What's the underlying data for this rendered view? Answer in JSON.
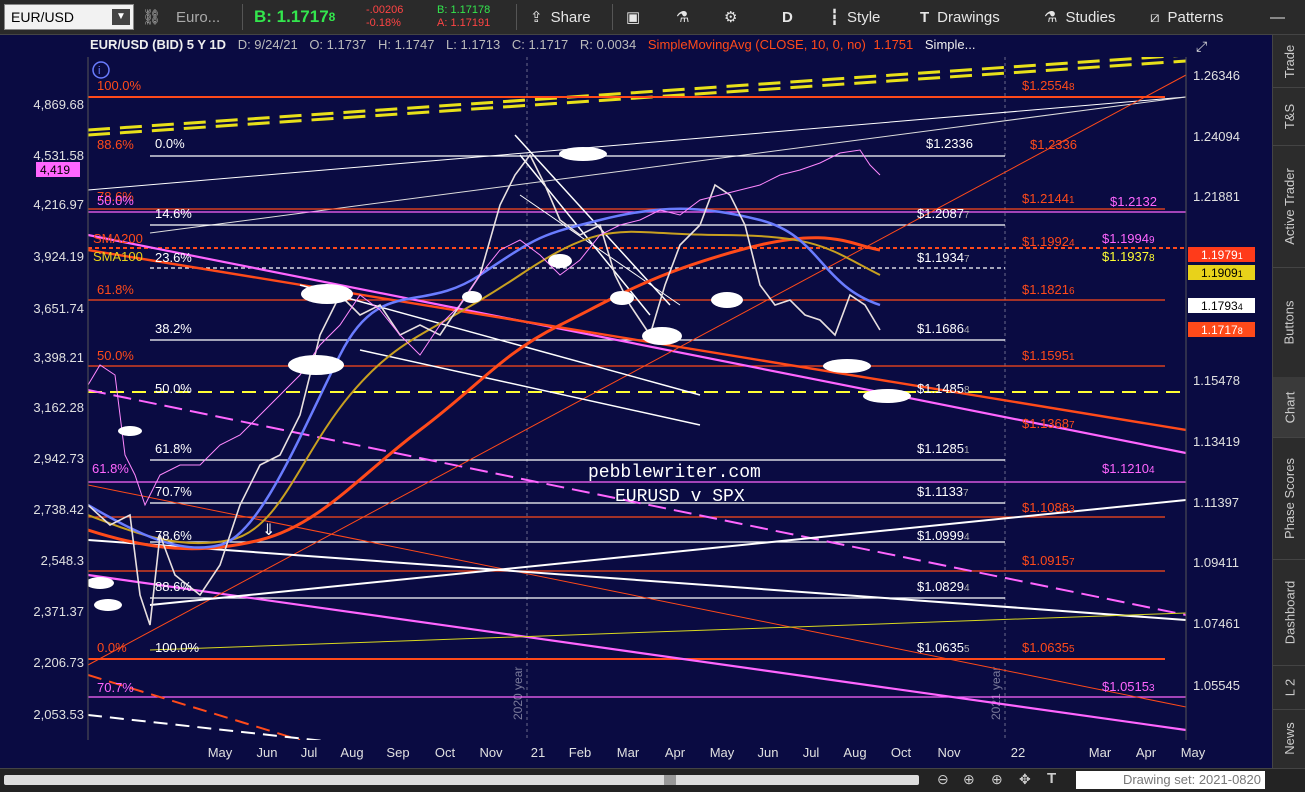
{
  "toolbar": {
    "symbol": "EUR/USD",
    "symbol_desc": "Euro...",
    "bid_label": "B: 1.1717",
    "bid_frac": "8",
    "change": "-.00206",
    "change_pct": "-0.18%",
    "bid_small": "B: 1.17178",
    "ask_small": "A: 1.17191",
    "share": "Share",
    "period": "D",
    "style": "Style",
    "drawings": "Drawings",
    "studies": "Studies",
    "patterns": "Patterns"
  },
  "header": {
    "title": "EUR/USD (BID) 5 Y 1D",
    "date": "D: 9/24/21",
    "open": "O: 1.1737",
    "high": "H: 1.1747",
    "low": "L: 1.1713",
    "close": "C: 1.1717",
    "range": "R: 0.0034",
    "study": "SimpleMovingAvg (CLOSE, 10, 0, no)",
    "study_value": "1.1751",
    "study2": "Simple..."
  },
  "colors": {
    "bg": "#0a0b42",
    "white": "#ffffff",
    "orange": "#ff4a1a",
    "magenta": "#ff66ff",
    "yellow": "#ffff33",
    "blue": "#6a7cff"
  },
  "right_axis": [
    "1.26346",
    "1.24094",
    "1.21881",
    "1.19",
    "1.17",
    "1.15478",
    "1.13419",
    "1.11397",
    "1.09411",
    "1.07461",
    "1.05545"
  ],
  "left_axis": [
    "4,869.68",
    "4,531.58",
    "4,216.97",
    "3,924.19",
    "3,651.74",
    "3,398.21",
    "3,162.28",
    "2,942.73",
    "2,738.42",
    "2,548.3",
    "2,371.37",
    "2,206.73",
    "2,053.53"
  ],
  "x_axis": [
    "May",
    "Jun",
    "Jul",
    "Aug",
    "Sep",
    "Oct",
    "Nov",
    "21",
    "Feb",
    "Mar",
    "Apr",
    "May",
    "Jun",
    "Jul",
    "Aug",
    "Oct",
    "Nov",
    "22",
    "Mar",
    "Apr",
    "May"
  ],
  "year_labels": [
    "2020 year",
    "2021 year"
  ],
  "fib_left": [
    "100.0%",
    "88.6%",
    "78.6%",
    "50.0%",
    "61.8%",
    "50.0%",
    "38.2%",
    "61.8%",
    "23.6%",
    "14.6%",
    "0.0%",
    "70.7%"
  ],
  "fib_white": [
    "0.0%",
    "14.6%",
    "23.6%",
    "38.2%",
    "50.0%",
    "61.8%",
    "70.7%",
    "78.6%",
    "88.6%",
    "100.0%"
  ],
  "white_prices": [
    "$1.2336",
    "$1.2087",
    "$1.1934",
    "$1.1686",
    "$1.1485",
    "$1.1285",
    "$1.1133",
    "$1.0999",
    "$1.0829",
    "$1.0635"
  ],
  "white_price_sub": [
    "",
    "7",
    "7",
    "4",
    "8",
    "1",
    "7",
    "4",
    "4",
    "5"
  ],
  "red_prices": [
    "$1.2554",
    "$1.2336",
    "$1.2144",
    "$1.1992",
    "$1.1821",
    "$1.1595",
    "$1.1368",
    "$1.1088",
    "$1.0915",
    "$1.0635"
  ],
  "red_price_sub": [
    "8",
    "",
    "1",
    "4",
    "6",
    "1",
    "7",
    "3",
    "7",
    "5"
  ],
  "magenta_prices": [
    "$1.2132",
    "$1.1994",
    "$1.1210",
    "$1.0515"
  ],
  "magenta_price_sub": [
    "",
    "9",
    "4",
    "3"
  ],
  "yellow_price": "$1.1937",
  "yellow_price_sub": "8",
  "sma_labels": [
    "SMA200",
    "SMA100"
  ],
  "spx_badge": "4,419",
  "price_badges": [
    {
      "text": "1.1979",
      "sub": "1",
      "bg": "#ff3b1a",
      "fg": "#ffffff"
    },
    {
      "text": "1.1909",
      "sub": "1",
      "bg": "#e8d21a",
      "fg": "#000000"
    },
    {
      "text": "1.1793",
      "sub": "4",
      "bg": "#ffffff",
      "fg": "#000000"
    },
    {
      "text": "1.1717",
      "sub": "8",
      "bg": "#ff4a1a",
      "fg": "#ffffff"
    }
  ],
  "watermark": [
    "pebblewriter.com",
    "EURUSD v SPX"
  ],
  "right_tabs": [
    "Trade",
    "T&S",
    "Active Trader",
    "Buttons",
    "Chart",
    "Phase Scores",
    "Dashboard",
    "L 2",
    "News"
  ],
  "bottom": {
    "drawing_set": "Drawing set: 2021-0820"
  }
}
